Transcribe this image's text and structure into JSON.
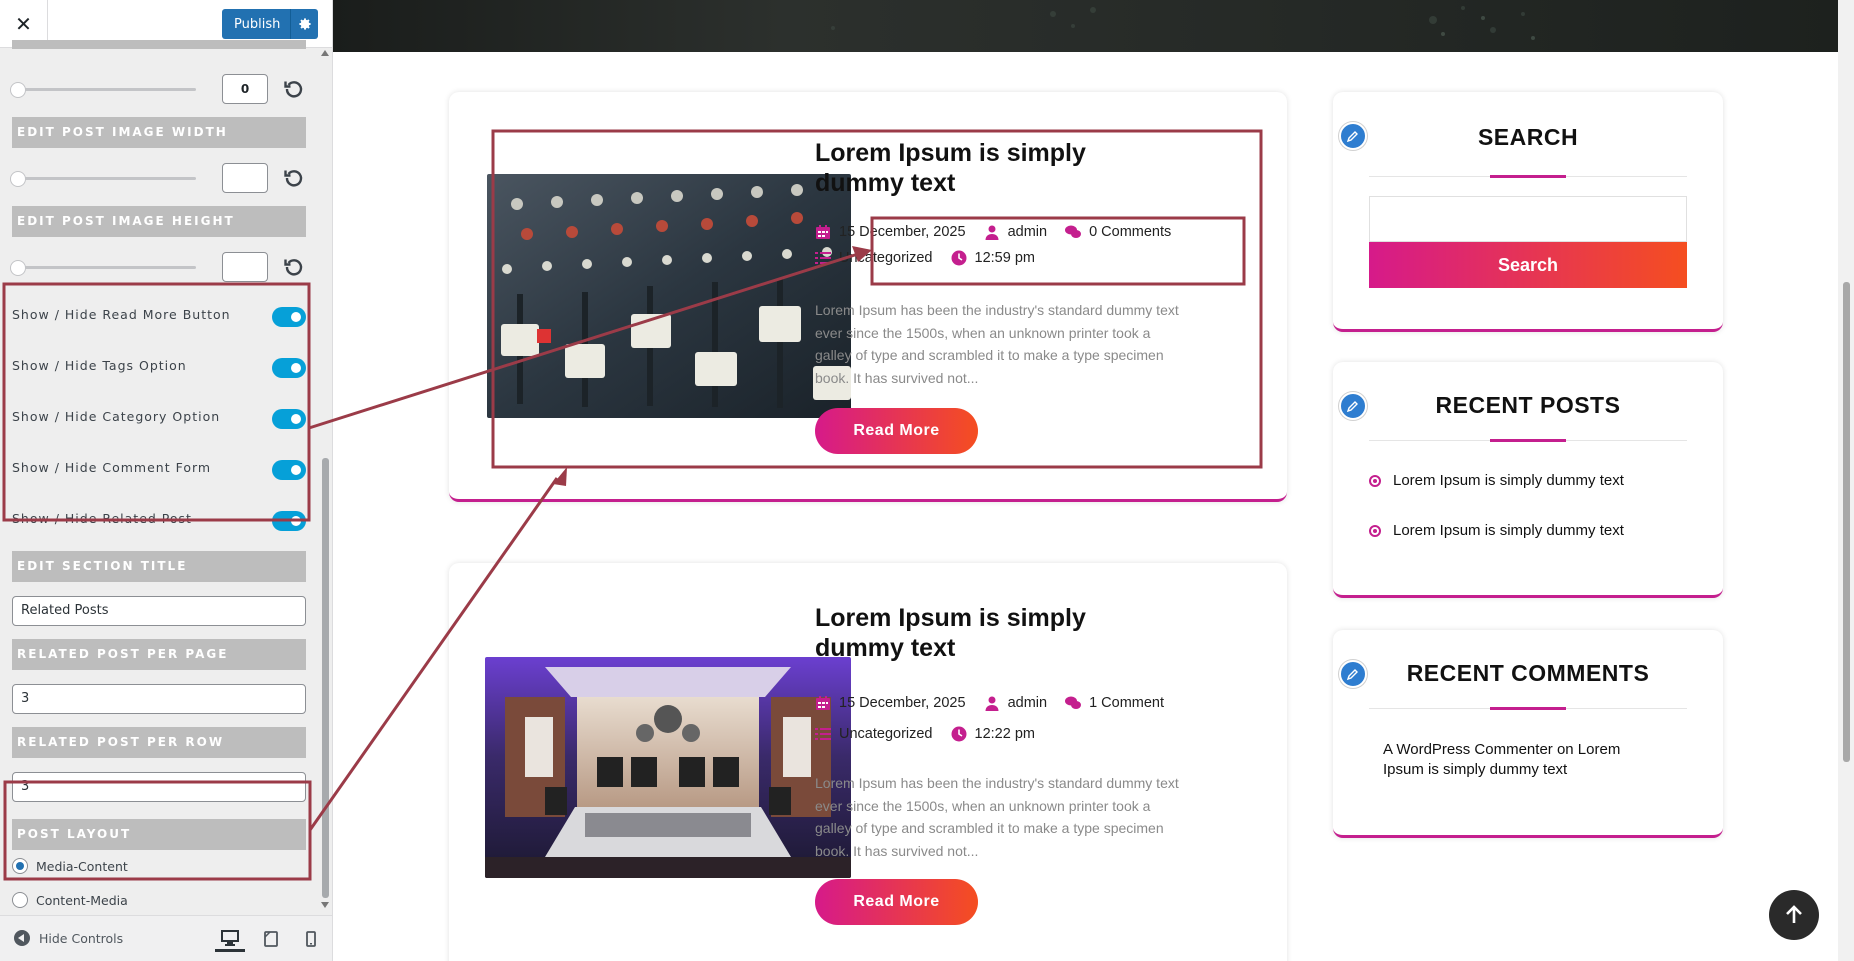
{
  "customizer": {
    "close_label": "✕",
    "publish_label": "Publish",
    "slider_value": "0",
    "sections": {
      "image_width": "EDIT POST IMAGE WIDTH",
      "image_height": "EDIT POST IMAGE HEIGHT",
      "section_title": "EDIT SECTION TITLE",
      "per_page": "RELATED POST PER PAGE",
      "per_row": "RELATED POST PER ROW",
      "layout": "POST LAYOUT"
    },
    "toggles": [
      {
        "label": "Show / Hide Read More Button",
        "on": true
      },
      {
        "label": "Show / Hide Tags Option",
        "on": true
      },
      {
        "label": "Show / Hide Category Option",
        "on": true
      },
      {
        "label": "Show / Hide Comment Form",
        "on": true
      },
      {
        "label": "Show / Hide Related Post",
        "on": true
      }
    ],
    "section_title_value": "Related Posts",
    "per_page_value": "3",
    "per_row_value": "3",
    "layout_options": [
      {
        "label": "Media-Content",
        "selected": true
      },
      {
        "label": "Content-Media",
        "selected": false
      }
    ],
    "hide_controls_label": "Hide Controls"
  },
  "posts": [
    {
      "title": "Lorem Ipsum is simply dummy text",
      "date": "15 December, 2025",
      "author": "admin",
      "comments": "0 Comments",
      "category": "Uncategorized",
      "time": "12:59 pm",
      "excerpt": "Lorem Ipsum has been the industry's standard dummy text ever since the 1500s, when an unknown printer took a galley of type and scrambled it to make a type specimen book. It has survived not...",
      "read_more": "Read More"
    },
    {
      "title": "Lorem Ipsum is simply dummy text",
      "date": "15 December, 2025",
      "author": "admin",
      "comments": "1 Comment",
      "category": "Uncategorized",
      "time": "12:22 pm",
      "excerpt": "Lorem Ipsum has been the industry's standard dummy text ever since the 1500s, when an unknown printer took a galley of type and scrambled it to make a type specimen book. It has survived not...",
      "read_more": "Read More"
    }
  ],
  "widgets": {
    "search": {
      "title": "SEARCH",
      "button": "Search"
    },
    "recent_posts": {
      "title": "RECENT POSTS",
      "items": [
        "Lorem Ipsum is simply dummy text",
        "Lorem Ipsum is simply dummy text"
      ]
    },
    "recent_comments": {
      "title": "RECENT COMMENTS",
      "text": "A WordPress Commenter on Lorem Ipsum is simply dummy text"
    }
  },
  "colors": {
    "accent": "#c41f8e",
    "gradient_start": "#d61a8a",
    "gradient_end": "#f54e20",
    "toggle_on": "#06a0d8",
    "publish": "#2271b1",
    "annotation": "#9b3b48"
  }
}
